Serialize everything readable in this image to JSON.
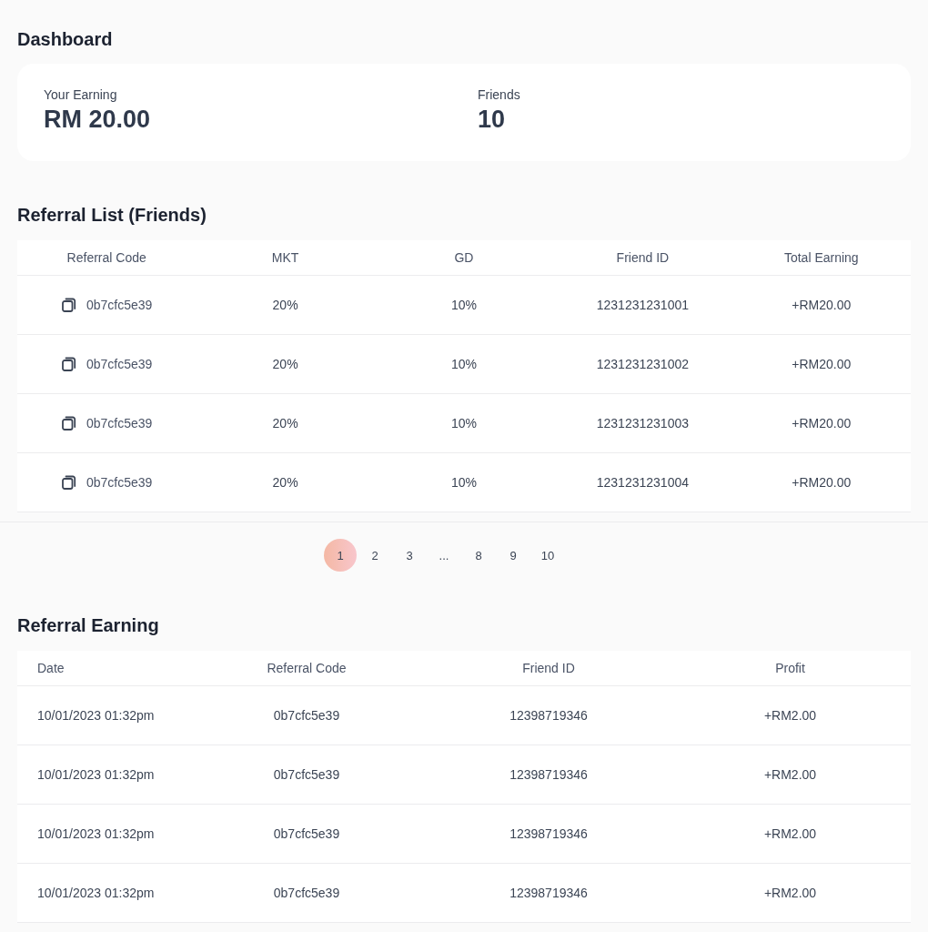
{
  "dashboard": {
    "title": "Dashboard",
    "stats": [
      {
        "label": "Your Earning",
        "value": "RM 20.00"
      },
      {
        "label": "Friends",
        "value": "10"
      }
    ]
  },
  "referral_list": {
    "title": "Referral List (Friends)",
    "columns": [
      "Referral Code",
      "MKT",
      "GD",
      "Friend ID",
      "Total Earning"
    ],
    "rows": [
      {
        "referral_code": "0b7cfc5e39",
        "mkt": "20%",
        "gd": "10%",
        "friend_id": "1231231231001",
        "total_earning": "+RM20.00"
      },
      {
        "referral_code": "0b7cfc5e39",
        "mkt": "20%",
        "gd": "10%",
        "friend_id": "1231231231002",
        "total_earning": "+RM20.00"
      },
      {
        "referral_code": "0b7cfc5e39",
        "mkt": "20%",
        "gd": "10%",
        "friend_id": "1231231231003",
        "total_earning": "+RM20.00"
      },
      {
        "referral_code": "0b7cfc5e39",
        "mkt": "20%",
        "gd": "10%",
        "friend_id": "1231231231004",
        "total_earning": "+RM20.00"
      }
    ]
  },
  "pagination": [
    {
      "label": "1",
      "selected": true
    },
    {
      "label": "2",
      "selected": false
    },
    {
      "label": "3",
      "selected": false
    },
    {
      "label": "...",
      "selected": false
    },
    {
      "label": "8",
      "selected": false
    },
    {
      "label": "9",
      "selected": false
    },
    {
      "label": "10",
      "selected": false
    }
  ],
  "referral_earning": {
    "title": "Referral Earning",
    "columns": [
      "Date",
      "Referral Code",
      "Friend ID",
      "Profit"
    ],
    "rows": [
      {
        "date": "10/01/2023 01:32pm",
        "referral_code": "0b7cfc5e39",
        "friend_id": "12398719346",
        "profit": "+RM2.00"
      },
      {
        "date": "10/01/2023 01:32pm",
        "referral_code": "0b7cfc5e39",
        "friend_id": "12398719346",
        "profit": "+RM2.00"
      },
      {
        "date": "10/01/2023 01:32pm",
        "referral_code": "0b7cfc5e39",
        "friend_id": "12398719346",
        "profit": "+RM2.00"
      },
      {
        "date": "10/01/2023 01:32pm",
        "referral_code": "0b7cfc5e39",
        "friend_id": "12398719346",
        "profit": "+RM2.00"
      }
    ]
  }
}
